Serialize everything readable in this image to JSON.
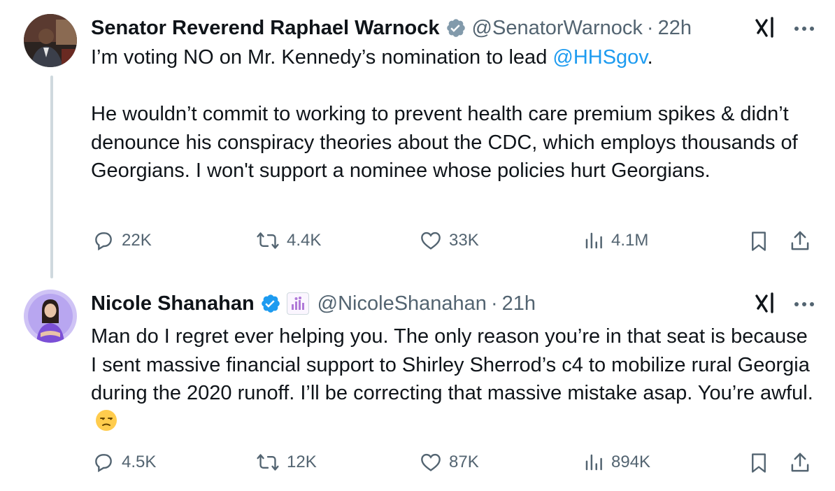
{
  "tweets": [
    {
      "author": {
        "name": "Senator Reverend Raphael Warnock",
        "verified": "gray-verified-badge",
        "handle": "@SenatorWarnock",
        "separator": "·",
        "time": "22h"
      },
      "text": {
        "line1_before": "I’m voting NO on Mr. Kennedy’s nomination to lead ",
        "mention": "@HHSgov",
        "line1_after": ".",
        "paragraph2": "He wouldn’t commit to working to prevent health care premium spikes & didn’t denounce his conspiracy theories about the CDC, which employs thousands of Georgians. I won't support a nominee whose policies hurt Georgians."
      },
      "stats": {
        "replies": "22K",
        "reposts": "4.4K",
        "likes": "33K",
        "views": "4.1M"
      }
    },
    {
      "author": {
        "name": "Nicole Shanahan",
        "verified": "blue-verified-badge",
        "handle": "@NicoleShanahan",
        "separator": "·",
        "time": "21h"
      },
      "text": {
        "body": "Man do I regret ever helping you. The only reason you’re in that seat is because I sent massive financial support to Shirley Sherrod’s c4 to mobilize rural Georgia during the 2020 runoff. I’ll be correcting that massive mistake asap. You’re awful.",
        "emoji": "unamused-face-emoji"
      },
      "stats": {
        "replies": "4.5K",
        "reposts": "12K",
        "likes": "87K",
        "views": "894K"
      }
    }
  ],
  "colors": {
    "text": "#0f1419",
    "secondary": "#536471",
    "link": "#1d9bf0",
    "thread_line": "#cfd9de"
  },
  "icons": [
    "reply-icon",
    "repost-icon",
    "like-icon",
    "views-icon",
    "bookmark-icon",
    "share-icon",
    "grok-icon",
    "more-icon"
  ]
}
